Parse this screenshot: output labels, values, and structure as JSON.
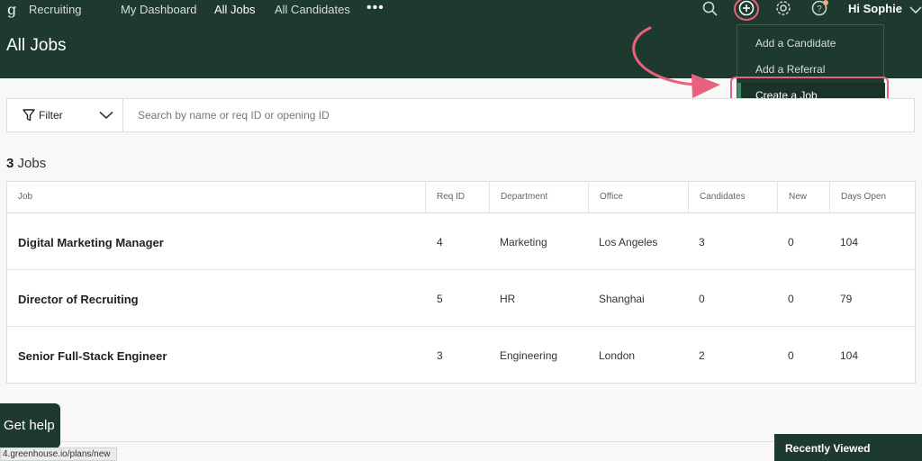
{
  "topnav": {
    "brand": "Recruiting",
    "links": [
      "My Dashboard",
      "All Jobs",
      "All Candidates"
    ],
    "active_link": "All Jobs",
    "more": "•••",
    "user": "Hi Sophie"
  },
  "icons": [
    "logo-icon",
    "search-icon",
    "plus-circle-icon",
    "gear-icon",
    "help-icon",
    "chevron-down-icon",
    "filter-icon"
  ],
  "page_title": "All Jobs",
  "add_menu": {
    "items": [
      "Add a Candidate",
      "Add a Referral",
      "Create a Job"
    ],
    "highlighted": "Create a Job"
  },
  "filter": {
    "label": "Filter",
    "search_placeholder": "Search by name or req ID or opening ID"
  },
  "jobs_count": {
    "number": "3",
    "label": "Jobs"
  },
  "table": {
    "columns": [
      "Job",
      "Req ID",
      "Department",
      "Office",
      "Candidates",
      "New",
      "Days Open"
    ],
    "rows": [
      {
        "job": "Digital Marketing Manager",
        "req_id": "4",
        "department": "Marketing",
        "office": "Los Angeles",
        "candidates": "3",
        "new": "0",
        "days_open": "104"
      },
      {
        "job": "Director of Recruiting",
        "req_id": "5",
        "department": "HR",
        "office": "Shanghai",
        "candidates": "0",
        "new": "0",
        "days_open": "79"
      },
      {
        "job": "Senior Full-Stack Engineer",
        "req_id": "3",
        "department": "Engineering",
        "office": "London",
        "candidates": "2",
        "new": "0",
        "days_open": "104"
      }
    ]
  },
  "footer": {
    "get_help": "Get help",
    "status_url": "4.greenhouse.io/plans/new",
    "recently_viewed": "Recently Viewed"
  },
  "colors": {
    "header_bg": "#1e3a2f",
    "annotation": "#e8617d",
    "accent_green": "#3f8a67"
  }
}
